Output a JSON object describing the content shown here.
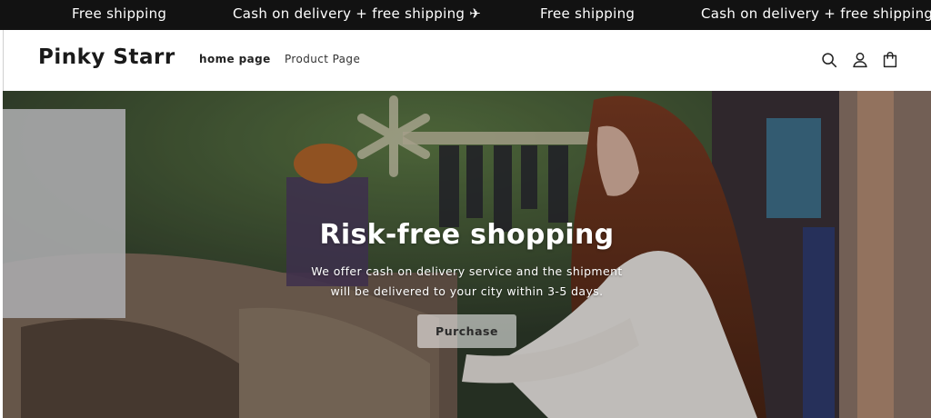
{
  "announcement": {
    "messages": [
      "Free shipping",
      "Cash on delivery + free shipping ✈",
      "Free shipping",
      "Cash on delivery + free shipping ✈"
    ]
  },
  "header": {
    "logo": "Pinky Starr",
    "nav": [
      {
        "label": "home page"
      },
      {
        "label": "Product Page"
      }
    ],
    "icons": [
      "search-icon",
      "account-icon",
      "cart-icon"
    ]
  },
  "hero": {
    "title": "Risk-free shopping",
    "subtitle_line1": "We offer cash on delivery service and the shipment",
    "subtitle_line2": "will be delivered to your city within 3-5 days.",
    "cta_label": "Purchase"
  },
  "colors": {
    "announcement_bg": "#121212",
    "header_bg": "#ffffff",
    "text_dark": "#1a1a1a"
  }
}
